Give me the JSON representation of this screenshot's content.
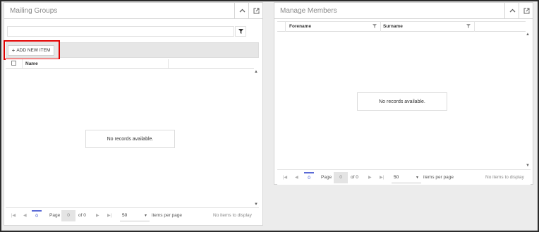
{
  "mailing_groups": {
    "title": "Mailing Groups",
    "add_button_label": "ADD NEW ITEM",
    "add_icon": "+",
    "columns": [
      "Name"
    ],
    "empty_message": "No records available.",
    "pager": {
      "current_page": "0",
      "page_label": "Page",
      "page_input": "0",
      "of_label": "of 0",
      "page_size": "50",
      "items_per_page_label": "items per page",
      "status": "No items to display"
    }
  },
  "manage_members": {
    "title": "Manage Members",
    "columns": [
      "Forename",
      "Surname"
    ],
    "empty_message": "No records available.",
    "pager": {
      "current_page": "0",
      "page_label": "Page",
      "page_input": "0",
      "of_label": "of 0",
      "page_size": "50",
      "items_per_page_label": "items per page",
      "status": "No items to display"
    }
  },
  "colors": {
    "highlight": "#e00000",
    "accent": "#3a4fc9"
  }
}
